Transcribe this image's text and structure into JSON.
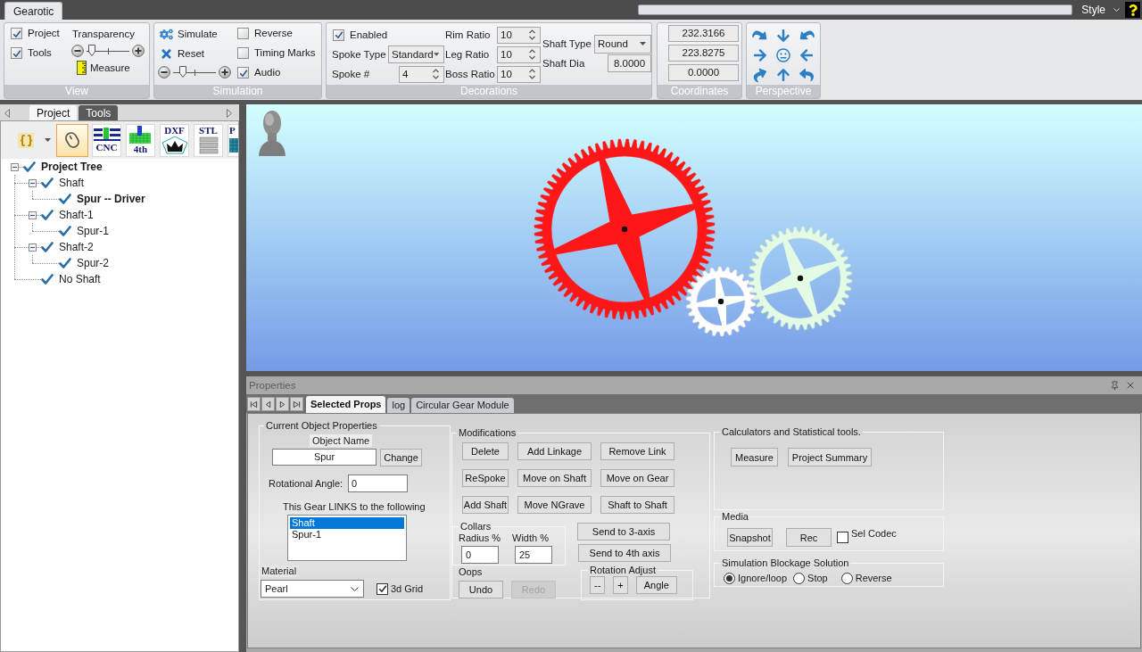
{
  "app_tabs": [
    {
      "label": "Gearotic",
      "selected": true
    }
  ],
  "top_bar": {
    "style_menu": "Style"
  },
  "ribbon": {
    "view": {
      "label": "View",
      "checks": [
        {
          "label": "Project",
          "checked": true
        },
        {
          "label": "Tools",
          "checked": true
        }
      ],
      "transparency": {
        "label": "Transparency",
        "level": 0.05
      },
      "measure": "Measure"
    },
    "simulation": {
      "label": "Simulation",
      "simulate": "Simulate",
      "reset": "Reset",
      "speed": {
        "level": 0.18
      },
      "checks": [
        {
          "label": "Reverse",
          "checked": false
        },
        {
          "label": "Timing Marks",
          "checked": false
        },
        {
          "label": "Audio",
          "checked": true
        }
      ]
    },
    "decorations": {
      "label": "Decorations",
      "enabled": {
        "label": "Enabled",
        "checked": true
      },
      "spoke_type": {
        "label": "Spoke Type",
        "value": "Standard"
      },
      "spoke_count": {
        "label": "Spoke #",
        "value": "4"
      },
      "ratios": [
        {
          "label": "Rim Ratio",
          "value": "10"
        },
        {
          "label": "Leg Ratio",
          "value": "10"
        },
        {
          "label": "Boss Ratio",
          "value": "10"
        }
      ],
      "shaft_type": {
        "label": "Shaft Type",
        "value": "Round"
      },
      "shaft_dia": {
        "label": "Shaft Dia",
        "value": "8.0000"
      }
    },
    "coordinates": {
      "label": "Coordinates",
      "values": [
        "232.3166",
        "223.8275",
        "0.0000"
      ]
    },
    "perspective": {
      "label": "Perspective"
    }
  },
  "left_panel": {
    "tabs": [
      {
        "label": "Project",
        "selected": true
      },
      {
        "label": "Tools",
        "selected": false
      }
    ],
    "tools": [
      {
        "kind": "script",
        "selected": false
      },
      {
        "kind": "mouse",
        "selected": true
      },
      {
        "kind": "cnc",
        "label": "CNC",
        "selected": false
      },
      {
        "kind": "fourth_axis",
        "label": "4th",
        "selected": false
      },
      {
        "kind": "dxf",
        "label": "DXF",
        "selected": false
      },
      {
        "kind": "stl",
        "label": "STL",
        "selected": false
      },
      {
        "kind": "partial",
        "label": "P",
        "selected": false
      }
    ],
    "tree": [
      {
        "label": "Project Tree",
        "checked": true,
        "bold": true,
        "expanded": true,
        "children": [
          {
            "label": "Shaft",
            "checked": true,
            "bold": false,
            "expanded": true,
            "children": [
              {
                "label": "Spur -- Driver",
                "checked": true,
                "bold": true
              }
            ]
          },
          {
            "label": "Shaft-1",
            "checked": true,
            "bold": false,
            "expanded": true,
            "children": [
              {
                "label": "Spur-1",
                "checked": true,
                "bold": false
              }
            ]
          },
          {
            "label": "Shaft-2",
            "checked": true,
            "bold": false,
            "expanded": true,
            "children": [
              {
                "label": "Spur-2",
                "checked": true,
                "bold": false
              }
            ]
          },
          {
            "label": "No Shaft",
            "checked": true,
            "bold": false
          }
        ]
      }
    ]
  },
  "properties": {
    "title": "Properties",
    "tabs": [
      {
        "label": "Selected Props",
        "selected": true
      },
      {
        "label": "log",
        "selected": false
      },
      {
        "label": "Circular Gear Module",
        "selected": false
      }
    ],
    "current_object": {
      "title": "Current Object Properties",
      "name_label": "Object Name",
      "name_value": "Spur",
      "change_button": "Change",
      "angle_label": "Rotational Angle:",
      "angle_value": "0",
      "links_label": "This Gear LINKS to the following",
      "links": [
        {
          "label": "Shaft",
          "selected": true
        },
        {
          "label": "Spur-1",
          "selected": false
        }
      ],
      "material_label": "Material",
      "material_value": "Pearl",
      "grid": {
        "label": "3d Grid",
        "checked": true
      }
    },
    "modifications": {
      "title": "Modifications",
      "buttons": [
        "Delete",
        "Add Linkage",
        "Remove Link",
        "ReSpoke",
        "Move on Shaft",
        "Move on Gear",
        "Add Shaft",
        "Move NGrave",
        "Shaft to Shaft"
      ],
      "collars": {
        "title": "Collars",
        "fields": [
          {
            "label": "Radius %",
            "value": "0"
          },
          {
            "label": "Width %",
            "value": "25"
          }
        ]
      },
      "oops": {
        "title": "Oops",
        "buttons": [
          {
            "label": "Undo",
            "disabled": false
          },
          {
            "label": "Redo",
            "disabled": true
          }
        ]
      },
      "send_buttons": [
        "Send to 3-axis",
        "Send to 4th axis"
      ],
      "rotation_adjust": {
        "title": "Rotation Adjust",
        "buttons": [
          "--",
          "+",
          "Angle"
        ]
      }
    },
    "calculators": {
      "title": "Calculators and Statistical tools.",
      "buttons": [
        "Measure",
        "Project Summary"
      ]
    },
    "media": {
      "title": "Media",
      "buttons": [
        "Snapshot",
        "Rec"
      ],
      "codec": {
        "label": "Sel Codec",
        "checked": false
      }
    },
    "blockage": {
      "title": "Simulation Blockage Solution",
      "options": [
        {
          "label": "Ignore/loop",
          "selected": true
        },
        {
          "label": "Stop",
          "selected": false
        },
        {
          "label": "Reverse",
          "selected": false
        }
      ]
    }
  }
}
